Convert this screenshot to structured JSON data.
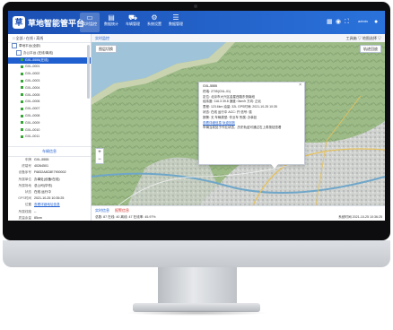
{
  "app": {
    "title": "草地智能管平台"
  },
  "nav": [
    {
      "icon": "monitor-icon",
      "label": "实时监控"
    },
    {
      "icon": "chart-icon",
      "label": "数据统计"
    },
    {
      "icon": "car-icon",
      "label": "车辆管理"
    },
    {
      "icon": "gear-icon",
      "label": "系统设置"
    },
    {
      "icon": "doc-icon",
      "label": "数据管理"
    }
  ],
  "header": {
    "user": "admin"
  },
  "sidebar": {
    "header": "□ 全部 / 在线 / 离线",
    "tree": [
      {
        "label": "草地平台(全部)",
        "level": 0,
        "type": "group"
      },
      {
        "label": "办公平台 (在线/离线)",
        "level": 1,
        "type": "group"
      },
      {
        "label": "GXL-5555(在线)",
        "level": 2,
        "type": "car",
        "selected": true
      },
      {
        "label": "GXL-0001",
        "level": 2,
        "type": "car"
      },
      {
        "label": "GXL-0002",
        "level": 2,
        "type": "car"
      },
      {
        "label": "GXL-0003",
        "level": 2,
        "type": "car"
      },
      {
        "label": "GXL-0004",
        "level": 2,
        "type": "car"
      },
      {
        "label": "GXL-0005",
        "level": 2,
        "type": "car"
      },
      {
        "label": "GXL-0006",
        "level": 2,
        "type": "car"
      },
      {
        "label": "GXL-0007",
        "level": 2,
        "type": "car"
      },
      {
        "label": "GXL-0008",
        "level": 2,
        "type": "car"
      },
      {
        "label": "GXL-0009",
        "level": 2,
        "type": "car"
      },
      {
        "label": "GXL-0010",
        "level": 2,
        "type": "car"
      },
      {
        "label": "GXL-0011",
        "level": 2,
        "type": "car"
      }
    ],
    "detail_header": "车辆信息",
    "details": [
      {
        "k": "车牌",
        "v": "GXL-5555"
      },
      {
        "k": "终端号",
        "v": "40264501"
      },
      {
        "k": "设备序号",
        "v": "F6832A8C8E7900002"
      },
      {
        "k": "所属单位",
        "v": "办事处(设备/在线)"
      },
      {
        "k": "所属场地",
        "v": "总公司(华东)"
      },
      {
        "k": "状态",
        "v": "在线 运行中"
      },
      {
        "k": "GPS时间",
        "v": "2021-10-25 10:35:25"
      },
      {
        "k": "位置",
        "v": "查看详细地址信息",
        "link": true
      },
      {
        "k": "所属线路",
        "v": "--"
      },
      {
        "k": "质量余量",
        "v": "85cm"
      },
      {
        "k": "离线时间",
        "v": "--"
      }
    ]
  },
  "content": {
    "tab_label": "实时监控",
    "tools": "工具箱 ▽   地图选择 ▽",
    "map_buttons": {
      "left": "图层切换",
      "right": "轨迹回放"
    },
    "popup": {
      "title": "GXL-5555",
      "lines": [
        "终端: 2705(CNL-01)",
        "定位: 北京市大兴区金星西路东侧南段",
        "经纬度: 116.3 39.8  速度: 0km/h  方向: 正北",
        "里程: 123.6km  油量: 32L  GPS时间: 2021-10-25 10:35",
        "状态: 在线 运行中  ACC: 开  信号: 强",
        "报警: 无  车辆类型: 作业车  所属: 办事处"
      ],
      "link": "查看详细信息 轨迹回放",
      "footer": "车辆当前处于作业状态，历史轨迹可通过右上角按钮查看"
    },
    "bottom_tabs": [
      "实时信息",
      "报警信息"
    ],
    "stats": "总数: 87    在线: 40    离线: 47    在线率: 45.97%",
    "time": "系统时间 2021-10-25 10:36:25"
  }
}
